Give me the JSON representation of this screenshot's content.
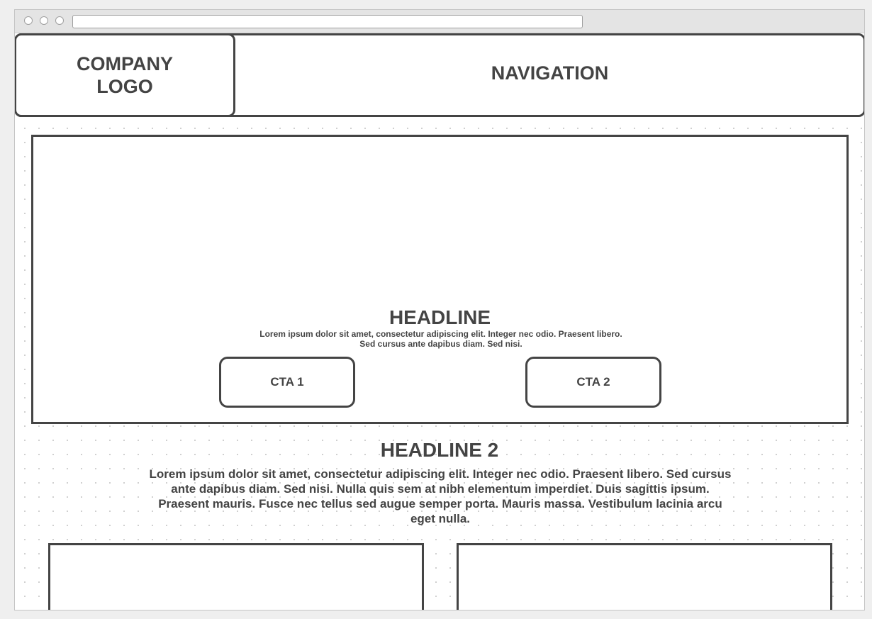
{
  "header": {
    "logo": "COMPANY LOGO",
    "navigation": "NAVIGATION"
  },
  "hero": {
    "headline": "HEADLINE",
    "body": "Lorem ipsum dolor sit amet, consectetur adipiscing elit. Integer nec odio. Praesent libero. Sed cursus ante dapibus diam. Sed nisi.",
    "cta_1": "CTA 1",
    "cta_2": "CTA 2"
  },
  "section": {
    "headline": "HEADLINE 2",
    "body": "Lorem ipsum dolor sit amet, consectetur adipiscing elit. Integer nec odio. Praesent libero. Sed cursus ante dapibus diam. Sed nisi. Nulla quis sem at nibh elementum imperdiet. Duis sagittis ipsum. Praesent mauris. Fusce nec tellus sed augue semper porta. Mauris massa. Vestibulum lacinia arcu eget nulla."
  },
  "colors": {
    "stroke": "#444444",
    "background": "#ffffff",
    "chrome": "#e4e4e4"
  }
}
